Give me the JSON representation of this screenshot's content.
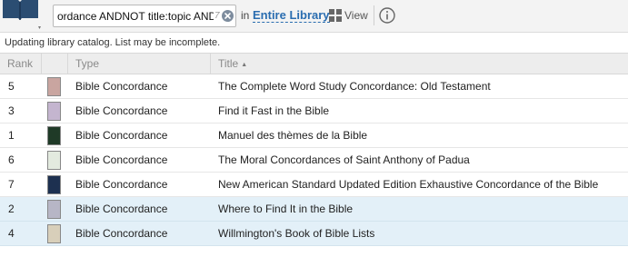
{
  "toolbar": {
    "search": {
      "value": "ordance ANDNOT title:topic AND",
      "count": "7"
    },
    "in_label": "in",
    "library_link": "Entire Library",
    "view_label": "View",
    "icons": {
      "library": "book-icon",
      "clear": "clear-circle-x-icon",
      "view": "grid-view-icon",
      "info": "info-icon"
    }
  },
  "status": {
    "message": "Updating library catalog. List may be incomplete."
  },
  "table": {
    "headers": {
      "rank": "Rank",
      "type": "Type",
      "title": "Title"
    },
    "sort": {
      "column": "title",
      "direction": "ascending",
      "icon": "sort-up-icon"
    },
    "rows": [
      {
        "rank": "5",
        "type": "Bible Concordance",
        "title": "The Complete Word Study Concordance: Old Testament",
        "cover_color": "#c9a5a0",
        "selected": false
      },
      {
        "rank": "3",
        "type": "Bible Concordance",
        "title": "Find it Fast in the Bible",
        "cover_color": "#c4b5cf",
        "selected": false
      },
      {
        "rank": "1",
        "type": "Bible Concordance",
        "title": "Manuel des thèmes de la Bible",
        "cover_color": "#1f3a27",
        "selected": false
      },
      {
        "rank": "6",
        "type": "Bible Concordance",
        "title": "The Moral Concordances of Saint Anthony of Padua",
        "cover_color": "#e3eadf",
        "selected": false
      },
      {
        "rank": "7",
        "type": "Bible Concordance",
        "title": "New American Standard Updated Edition Exhaustive Concordance of the Bible",
        "cover_color": "#1d3050",
        "selected": false
      },
      {
        "rank": "2",
        "type": "Bible Concordance",
        "title": "Where to Find It in the Bible",
        "cover_color": "#b7b6c6",
        "selected": true
      },
      {
        "rank": "4",
        "type": "Bible Concordance",
        "title": "Willmington's Book of Bible Lists",
        "cover_color": "#d8cfba",
        "selected": true
      }
    ]
  }
}
